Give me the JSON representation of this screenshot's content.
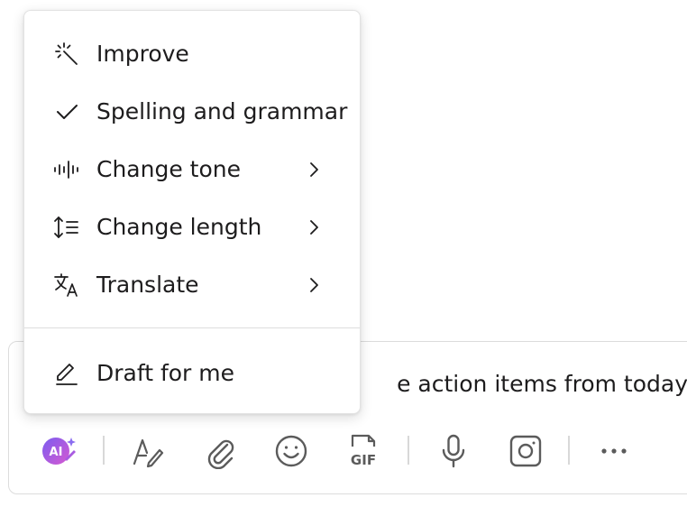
{
  "composer": {
    "visible_text": "e action items from today"
  },
  "menu": {
    "items": [
      {
        "label": "Improve",
        "icon": "magic-wand-icon",
        "submenu": false
      },
      {
        "label": "Spelling and grammar",
        "icon": "check-icon",
        "submenu": false
      },
      {
        "label": "Change tone",
        "icon": "waveform-icon",
        "submenu": true
      },
      {
        "label": "Change length",
        "icon": "text-length-icon",
        "submenu": true
      },
      {
        "label": "Translate",
        "icon": "translate-icon",
        "submenu": true
      }
    ],
    "footer_item": {
      "label": "Draft for me",
      "icon": "pencil-icon"
    }
  },
  "toolbar": {
    "ai_label": "AI",
    "gif_label": "GIF",
    "ai_gradient": [
      "#7b5cf0",
      "#d65ad1"
    ],
    "icon_color": "#5b5b5b"
  }
}
